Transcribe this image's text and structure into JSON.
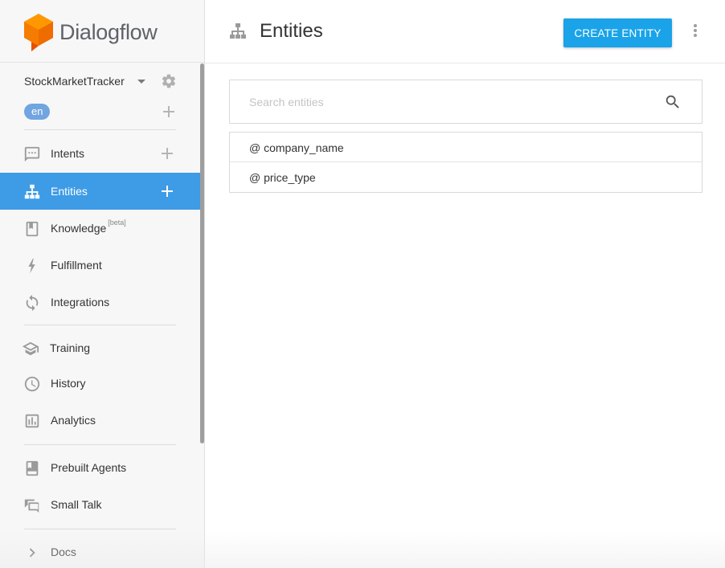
{
  "brand": {
    "name": "Dialogflow",
    "logo_color": "#f57c00"
  },
  "agent": {
    "name": "StockMarketTracker",
    "language": "en"
  },
  "nav": {
    "intents": "Intents",
    "entities": "Entities",
    "knowledge": "Knowledge",
    "knowledge_badge": "[beta]",
    "fulfillment": "Fulfillment",
    "integrations": "Integrations",
    "training": "Training",
    "history": "History",
    "analytics": "Analytics",
    "prebuilt_agents": "Prebuilt Agents",
    "small_talk": "Small Talk",
    "docs": "Docs"
  },
  "page": {
    "title": "Entities",
    "create_label": "CREATE ENTITY",
    "search_placeholder": "Search entities"
  },
  "entities": [
    "@ company_name",
    "@ price_type"
  ],
  "colors": {
    "active_nav": "#3e9be5",
    "primary_button": "#1aa3e8",
    "language_pill": "#70a5e0"
  }
}
